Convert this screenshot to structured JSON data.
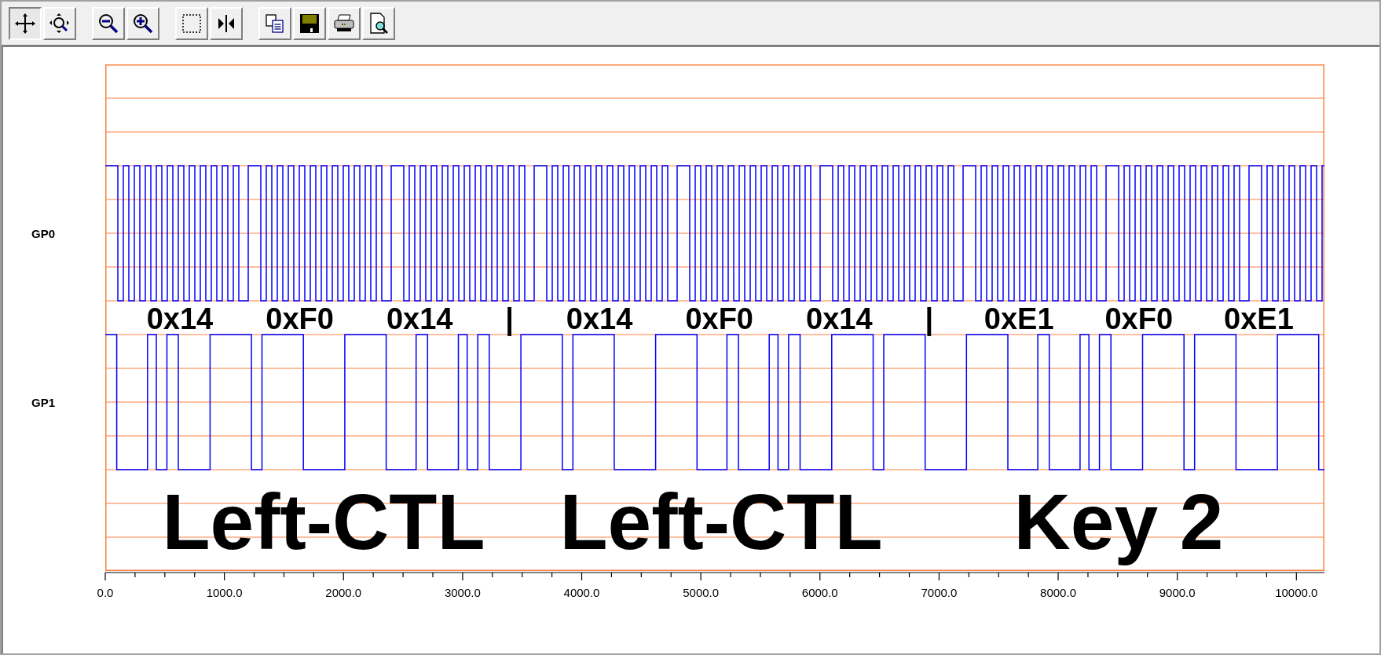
{
  "toolbar": [
    [
      {
        "selected": true
      },
      {
        "selected": false
      }
    ],
    [
      {
        "selected": false
      },
      {
        "selected": false
      }
    ],
    [
      {
        "selected": false
      },
      {
        "selected": false
      }
    ],
    [
      {
        "selected": false
      },
      {
        "selected": false
      },
      {
        "selected": false
      },
      {
        "selected": false
      }
    ]
  ],
  "channels": [
    {
      "name": "GP0"
    },
    {
      "name": "GP1"
    }
  ],
  "decode": [
    {
      "kind": "byte",
      "text": "0x14"
    },
    {
      "kind": "byte",
      "text": "0xF0"
    },
    {
      "kind": "byte",
      "text": "0x14"
    },
    {
      "kind": "separator",
      "text": "|"
    },
    {
      "kind": "byte",
      "text": "0x14"
    },
    {
      "kind": "byte",
      "text": "0xF0"
    },
    {
      "kind": "byte",
      "text": "0x14"
    },
    {
      "kind": "separator",
      "text": "|"
    },
    {
      "kind": "byte",
      "text": "0xE1"
    },
    {
      "kind": "byte",
      "text": "0xF0"
    },
    {
      "kind": "byte",
      "text": "0xE1"
    }
  ],
  "annotations": [
    "Left-CTL",
    "Left-CTL",
    "Key 2"
  ],
  "x_axis": {
    "ticks": [
      "0.0",
      "1000.0",
      "2000.0",
      "3000.0",
      "4000.0",
      "5000.0",
      "6000.0",
      "7000.0",
      "8000.0",
      "9000.0",
      "10000.0"
    ]
  }
}
